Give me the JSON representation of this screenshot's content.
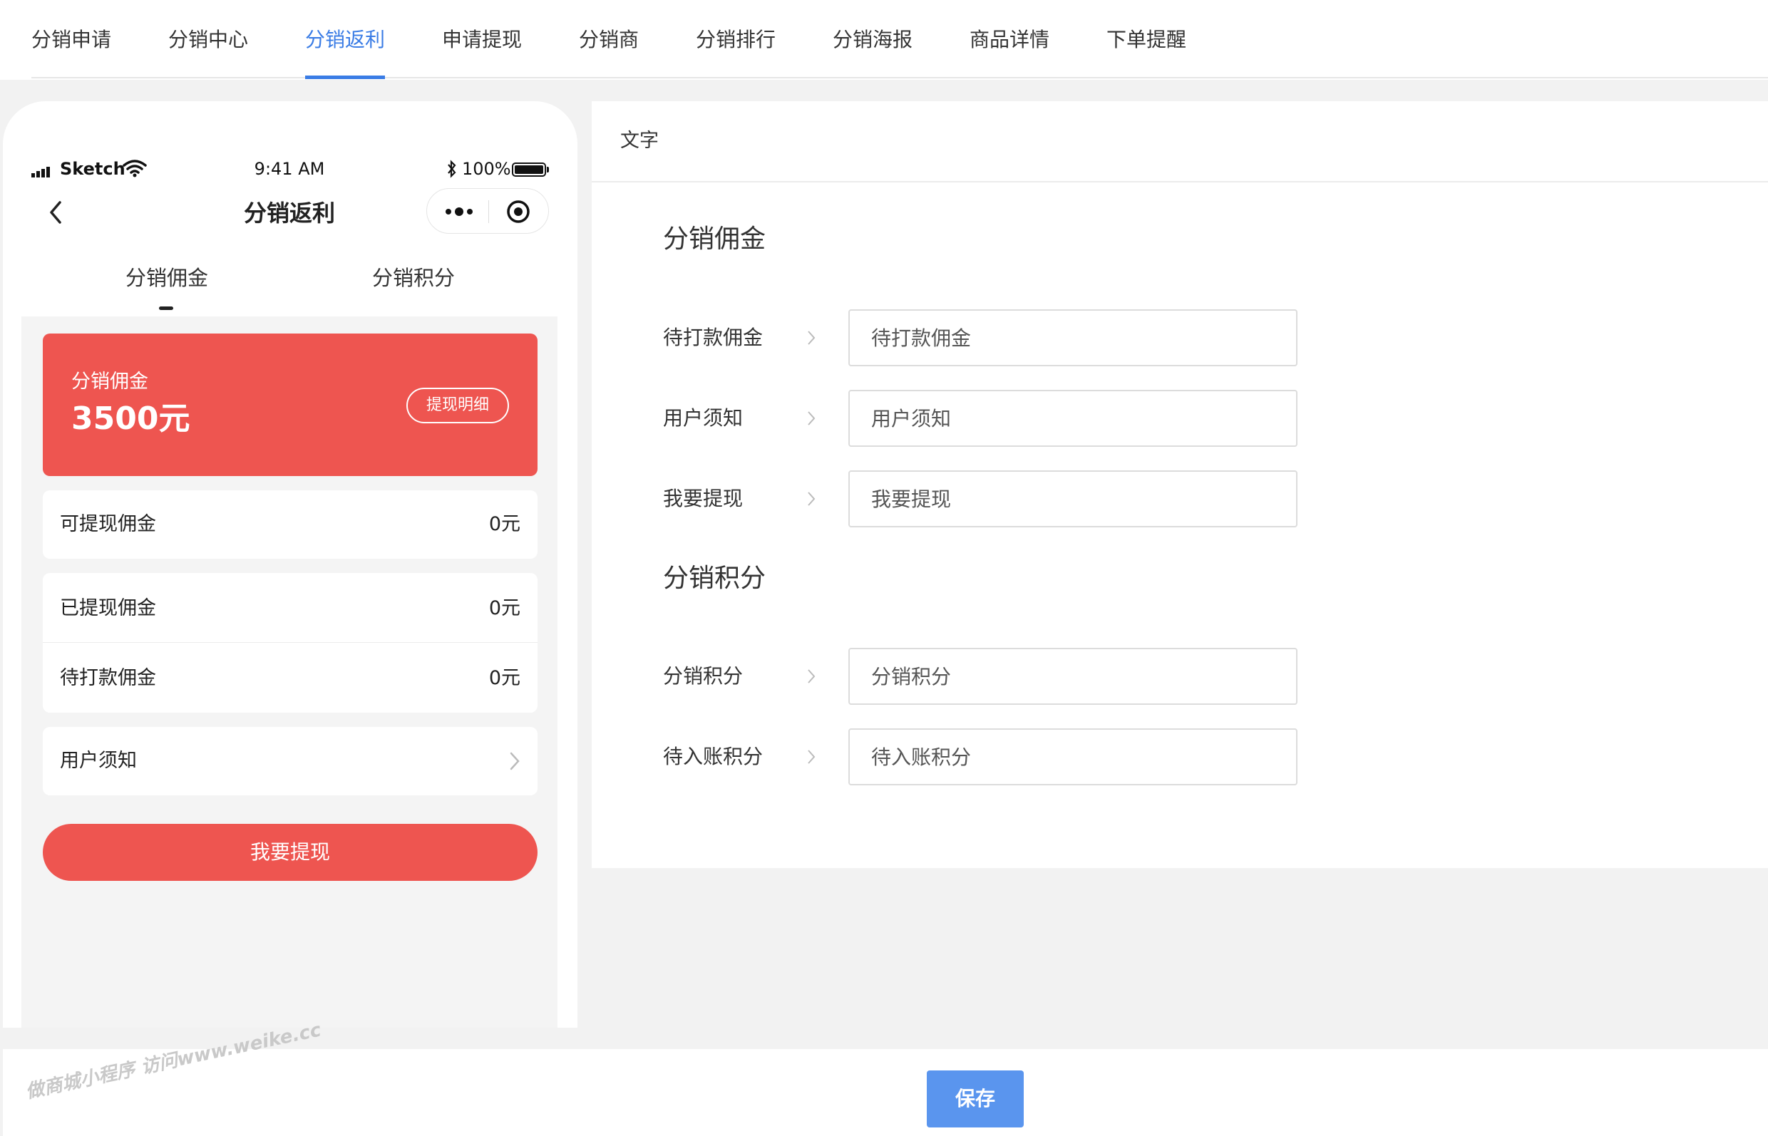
{
  "top_tabs": [
    {
      "label": "分销申请"
    },
    {
      "label": "分销中心"
    },
    {
      "label": "分销返利"
    },
    {
      "label": "申请提现"
    },
    {
      "label": "分销商"
    },
    {
      "label": "分销排行"
    },
    {
      "label": "分销海报"
    },
    {
      "label": "商品详情"
    },
    {
      "label": "下单提醒"
    }
  ],
  "active_tab": "分销返利",
  "accent_color": "#3a7ce5",
  "phone": {
    "status": {
      "carrier": "Sketch",
      "time": "9:41 AM",
      "battery": "100%"
    },
    "nav_title": "分销返利",
    "sub_tabs": [
      {
        "label": "分销佣金"
      },
      {
        "label": "分销积分"
      }
    ],
    "card": {
      "label": "分销佣金",
      "amount": "3500元",
      "detail_button": "提现明细",
      "color": "#ee5550"
    },
    "rows": [
      {
        "key": "可提现佣金",
        "value": "0元"
      },
      {
        "key": "已提现佣金",
        "value": "0元"
      },
      {
        "key": "待打款佣金",
        "value": "0元"
      },
      {
        "key": "用户须知",
        "icon": "chevron-right-icon"
      }
    ],
    "withdraw_button": "我要提现"
  },
  "panel": {
    "header": "文字",
    "sections": [
      {
        "title": "分销佣金",
        "fields": [
          {
            "label": "待打款佣金",
            "placeholder": "待打款佣金"
          },
          {
            "label": "用户须知",
            "placeholder": "用户须知"
          },
          {
            "label": "我要提现",
            "placeholder": "我要提现"
          }
        ]
      },
      {
        "title": "分销积分",
        "fields": [
          {
            "label": "分销积分",
            "placeholder": "分销积分"
          },
          {
            "label": "待入账积分",
            "placeholder": "待入账积分"
          }
        ]
      }
    ]
  },
  "save_button": "保存",
  "save_color": "#5a95ee",
  "watermark": "做商城小程序 访问www.weike.cc"
}
